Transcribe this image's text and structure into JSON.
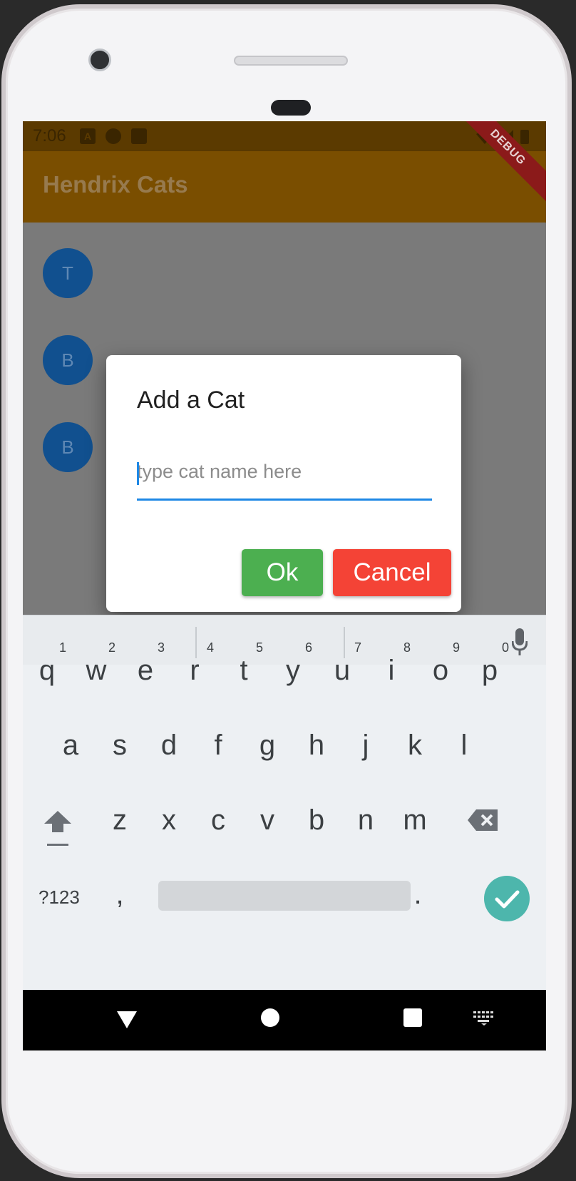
{
  "status_bar": {
    "time": "7:06"
  },
  "app_bar": {
    "title": "Hendrix Cats"
  },
  "debug_banner": "DEBUG",
  "cat_list": [
    {
      "initial": "T"
    },
    {
      "initial": "B"
    },
    {
      "initial": "B"
    }
  ],
  "dialog": {
    "title": "Add a Cat",
    "input_placeholder": "type cat name here",
    "ok_label": "Ok",
    "cancel_label": "Cancel"
  },
  "fab": {
    "icon": "plus-icon"
  },
  "keyboard": {
    "row1": [
      "q",
      "w",
      "e",
      "r",
      "t",
      "y",
      "u",
      "i",
      "o",
      "p"
    ],
    "row1_numbers": [
      "1",
      "2",
      "3",
      "4",
      "5",
      "6",
      "7",
      "8",
      "9",
      "0"
    ],
    "row2": [
      "a",
      "s",
      "d",
      "f",
      "g",
      "h",
      "j",
      "k",
      "l"
    ],
    "row3": [
      "z",
      "x",
      "c",
      "v",
      "b",
      "n",
      "m"
    ],
    "symbols_label": "?123",
    "comma": ",",
    "period": "."
  },
  "colors": {
    "app_bar": "#7a4e00",
    "avatar": "#11508f",
    "ok_button": "#4caf50",
    "cancel_button": "#f44336",
    "input_underline": "#1e88e5",
    "enter_key": "#4db6ac"
  }
}
